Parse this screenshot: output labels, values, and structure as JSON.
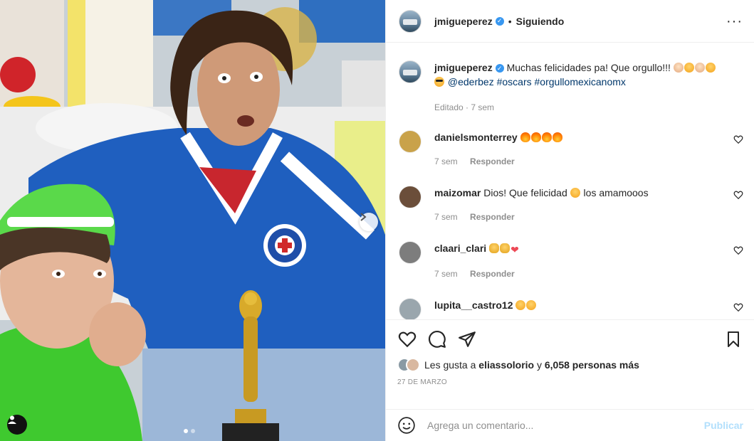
{
  "post": {
    "author": "jmigueperez",
    "follow_label": "Siguiendo",
    "separator": "•",
    "more_icon": "more-horizontal-icon"
  },
  "caption": {
    "username": "jmigueperez",
    "text": "Muchas felicidades pa! Que orgullo!!!",
    "mention": "@ederbez",
    "hashtags": [
      "#oscars",
      "#orgullomexicanomx"
    ],
    "meta": "Editado · 7 sem"
  },
  "comments": [
    {
      "username": "danielsmonterrey",
      "text": "",
      "emojis": [
        "fire",
        "fire",
        "fire",
        "fire"
      ],
      "time": "7 sem",
      "reply": "Responder",
      "avatar_color": "#c9a24a"
    },
    {
      "username": "maizomar",
      "text": "Dios! Que felicidad",
      "text_after": "los amamooos",
      "emojis": [
        "face"
      ],
      "time": "7 sem",
      "reply": "Responder",
      "avatar_color": "#6b4e3a"
    },
    {
      "username": "claari_clari",
      "text": "",
      "emojis": [
        "clap",
        "clap",
        "heart"
      ],
      "time": "7 sem",
      "reply": "Responder",
      "avatar_color": "#7d7d7d"
    },
    {
      "username": "lupita__castro12",
      "text": "",
      "emojis": [
        "face",
        "face"
      ],
      "time": "",
      "reply": "",
      "avatar_color": "#9aa6ad"
    }
  ],
  "likes": {
    "prefix": "Les gusta a",
    "user": "eliassolorio",
    "middle": "y",
    "count": "6,058 personas más"
  },
  "date": "27 DE MARZO",
  "add_comment": {
    "placeholder": "Agrega un comentario...",
    "publish_label": "Publicar"
  },
  "colors": {
    "link": "#00376b",
    "verified": "#3897f0",
    "muted": "#8e8e8e",
    "publish_disabled": "#b2dffc",
    "jersey_blue": "#1f5fbf"
  }
}
